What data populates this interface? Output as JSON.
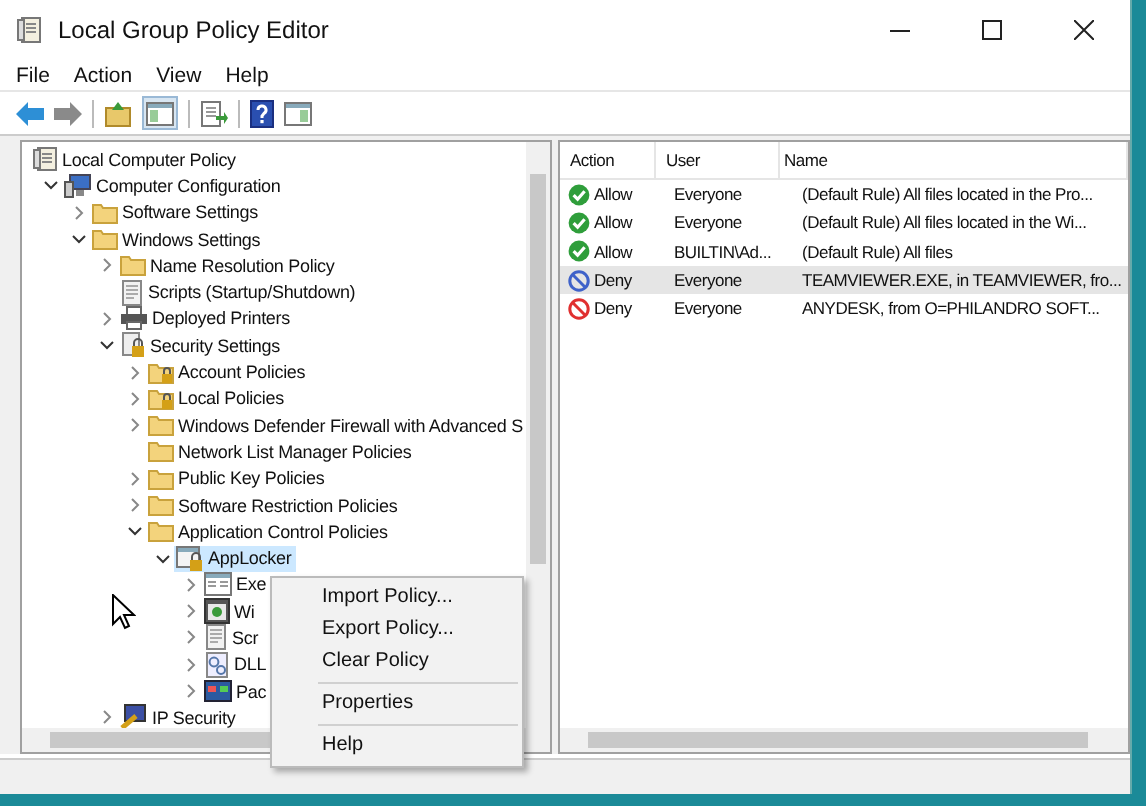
{
  "window": {
    "title": "Local Group Policy Editor"
  },
  "menu": [
    "File",
    "Action",
    "View",
    "Help"
  ],
  "tree": [
    {
      "label": "Local Computer Policy",
      "kind": "policy",
      "selected": false,
      "children": [
        {
          "label": "Computer Configuration",
          "kind": "computer",
          "expanded": true,
          "selected": false,
          "children": [
            {
              "label": "Software Settings",
              "kind": "folder",
              "expanded": false,
              "selected": false
            },
            {
              "label": "Windows Settings",
              "kind": "folder",
              "expanded": true,
              "selected": false,
              "children": [
                {
                  "label": "Name Resolution Policy",
                  "kind": "folder",
                  "expanded": false,
                  "selected": false
                },
                {
                  "label": "Scripts (Startup/Shutdown)",
                  "kind": "script",
                  "selected": false
                },
                {
                  "label": "Deployed Printers",
                  "kind": "printer",
                  "expanded": false,
                  "selected": false
                },
                {
                  "label": "Security Settings",
                  "kind": "security",
                  "expanded": true,
                  "selected": false,
                  "children": [
                    {
                      "label": "Account Policies",
                      "kind": "lockfolder",
                      "expanded": false,
                      "selected": false
                    },
                    {
                      "label": "Local Policies",
                      "kind": "lockfolder",
                      "expanded": false,
                      "selected": false
                    },
                    {
                      "label": "Windows Defender Firewall with Advanced S",
                      "kind": "folder",
                      "expanded": false,
                      "selected": false
                    },
                    {
                      "label": "Network List Manager Policies",
                      "kind": "folder",
                      "selected": false
                    },
                    {
                      "label": "Public Key Policies",
                      "kind": "folder",
                      "expanded": false,
                      "selected": false
                    },
                    {
                      "label": "Software Restriction Policies",
                      "kind": "folder",
                      "expanded": false,
                      "selected": false
                    },
                    {
                      "label": "Application Control Policies",
                      "kind": "folder",
                      "expanded": true,
                      "selected": false,
                      "children": [
                        {
                          "label": "AppLocker",
                          "kind": "applocker",
                          "expanded": true,
                          "selected": true,
                          "children": [
                            {
                              "label": "Exe",
                              "kind": "window",
                              "expanded": false,
                              "selected": false
                            },
                            {
                              "label": "Wi",
                              "kind": "installer",
                              "expanded": false,
                              "selected": false
                            },
                            {
                              "label": "Scr",
                              "kind": "script",
                              "expanded": false,
                              "selected": false
                            },
                            {
                              "label": "DLL",
                              "kind": "dll",
                              "expanded": false,
                              "selected": false
                            },
                            {
                              "label": "Pac",
                              "kind": "package",
                              "expanded": false,
                              "selected": false
                            }
                          ]
                        }
                      ]
                    }
                  ]
                },
                {
                  "label": "IP Security",
                  "kind": "ipsec",
                  "expanded": false,
                  "selected": false
                }
              ]
            }
          ]
        }
      ]
    }
  ],
  "rules": {
    "columns": [
      "Action",
      "User",
      "Name"
    ],
    "rows": [
      {
        "kind": "allow",
        "action": "Allow",
        "user": "Everyone",
        "name": "(Default Rule) All files located in the Pro...",
        "selected": false
      },
      {
        "kind": "allow",
        "action": "Allow",
        "user": "Everyone",
        "name": "(Default Rule) All files located in the Wi...",
        "selected": false
      },
      {
        "kind": "allow",
        "action": "Allow",
        "user": "BUILTIN\\Ad...",
        "name": "(Default Rule) All files",
        "selected": false
      },
      {
        "kind": "deny",
        "action": "Deny",
        "user": "Everyone",
        "name": "TEAMVIEWER.EXE, in TEAMVIEWER, fro...",
        "selected": true
      },
      {
        "kind": "deny",
        "action": "Deny",
        "user": "Everyone",
        "name": "ANYDESK, from O=PHILANDRO SOFT...",
        "selected": false
      }
    ]
  },
  "context_menu": [
    {
      "kind": "item",
      "label": "Import Policy..."
    },
    {
      "kind": "item",
      "label": "Export Policy..."
    },
    {
      "kind": "item",
      "label": "Clear Policy"
    },
    {
      "kind": "separator"
    },
    {
      "kind": "item",
      "label": "Properties"
    },
    {
      "kind": "separator"
    },
    {
      "kind": "item",
      "label": "Help"
    }
  ]
}
